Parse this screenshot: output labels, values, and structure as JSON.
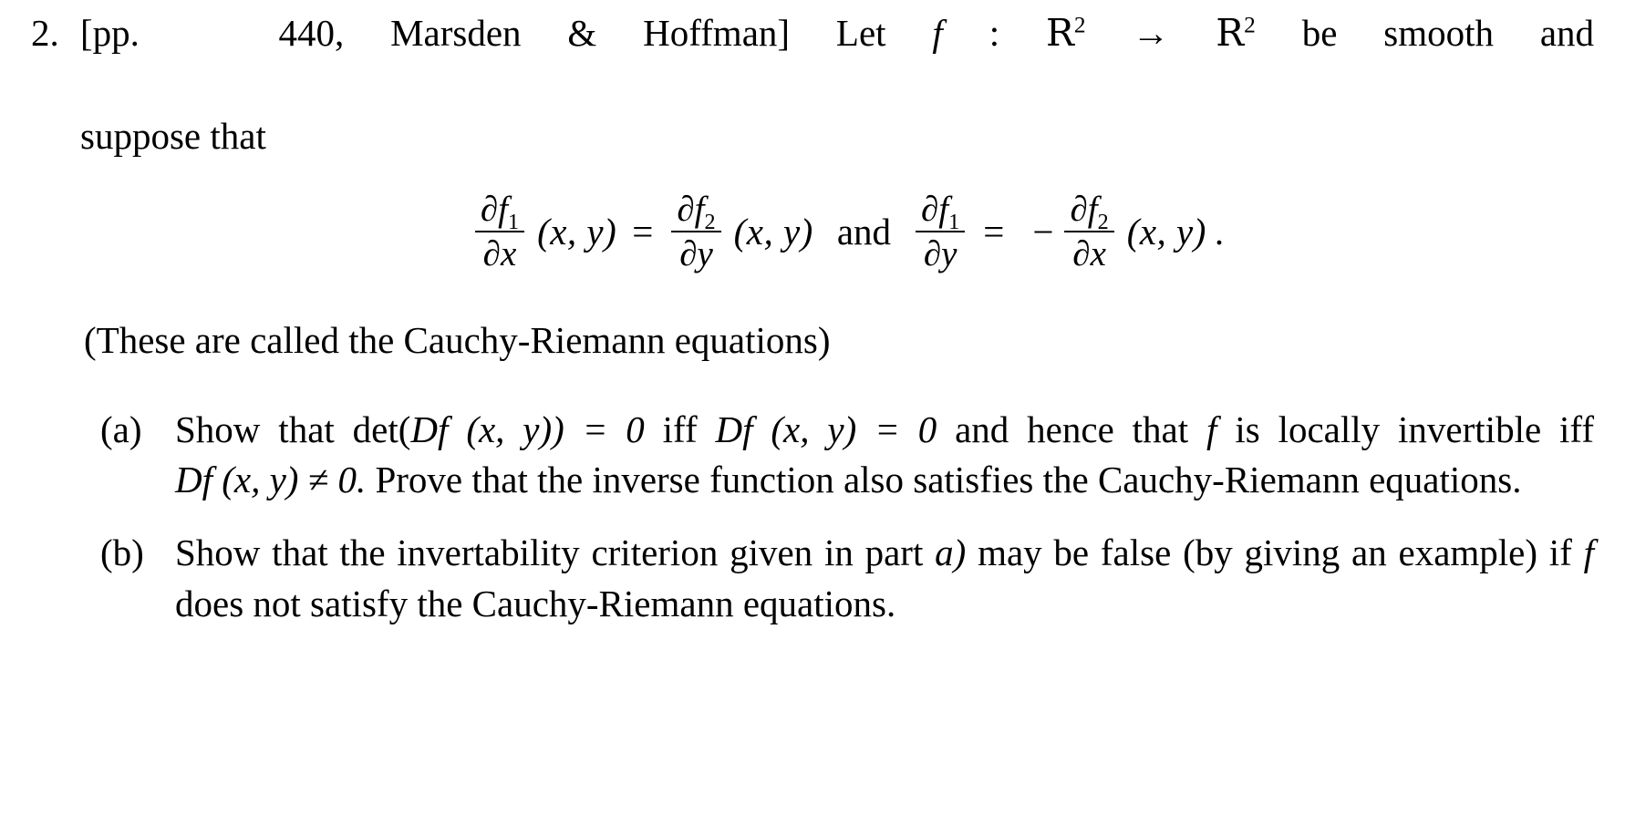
{
  "problem": {
    "number": "2.",
    "statement_prefix": "[pp.",
    "statement_page": "440,",
    "statement_source": "Marsden & Hoffman]",
    "statement_let": "Let",
    "function_symbol": "f",
    "colon": ":",
    "domain_symbol": "R",
    "domain_exponent": "2",
    "arrow": "→",
    "codomain_symbol": "R",
    "codomain_exponent": "2",
    "statement_tail": "be smooth and",
    "statement_line2": "suppose that"
  },
  "equation": {
    "lhs1": {
      "numerator_partial": "∂",
      "numerator_fn": "f",
      "numerator_sub": "1",
      "denominator_partial": "∂",
      "denominator_var": "x",
      "argument": "(x, y)"
    },
    "equals1": "=",
    "rhs1": {
      "numerator_partial": "∂",
      "numerator_fn": "f",
      "numerator_sub": "2",
      "denominator_partial": "∂",
      "denominator_var": "y",
      "argument": "(x, y)"
    },
    "conjunction": "and",
    "lhs2": {
      "numerator_partial": "∂",
      "numerator_fn": "f",
      "numerator_sub": "1",
      "denominator_partial": "∂",
      "denominator_var": "y"
    },
    "equals2": "=",
    "minus": "−",
    "rhs2": {
      "numerator_partial": "∂",
      "numerator_fn": "f",
      "numerator_sub": "2",
      "denominator_partial": "∂",
      "denominator_var": "x",
      "argument": "(x, y)"
    },
    "terminator": "."
  },
  "note": "(These are called the Cauchy-Riemann equations)",
  "parts": [
    {
      "label": "(a)",
      "segments": {
        "s1": "Show that det(",
        "m1": "Df",
        "s2": "(x, y)) = 0",
        "s3": "iff",
        "m2": "Df",
        "s4": "(x, y) = 0",
        "s5": "and hence that",
        "m3": "f",
        "s6": "is locally invertible iff",
        "m4": "Df",
        "s7": "(x, y) ≠ 0.",
        "s8": "Prove that the inverse function also satisfies the Cauchy-Riemann equations."
      }
    },
    {
      "label": "(b)",
      "segments": {
        "s1": "Show that the invertability criterion given in part",
        "m1": "a)",
        "s2": "may be false (by giving an example) if",
        "m2": "f",
        "s3": "does not satisfy the Cauchy-Riemann equations."
      }
    }
  ],
  "colors": {
    "ink": "#000000",
    "paper": "#ffffff"
  }
}
